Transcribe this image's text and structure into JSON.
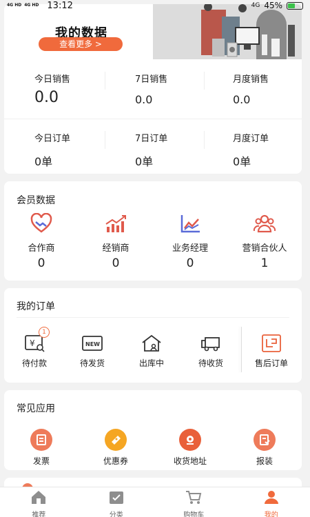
{
  "status": {
    "signal1": "4G HD",
    "signal2": "4G HD",
    "time": "13:12",
    "network": "4G",
    "battery": "45%"
  },
  "my_data": {
    "title": "我的数据",
    "more_btn": "查看更多 >",
    "sales": [
      {
        "label": "今日销售",
        "value": "0.0"
      },
      {
        "label": "7日销售",
        "value": "0.0"
      },
      {
        "label": "月度销售",
        "value": "0.0"
      }
    ],
    "orders": [
      {
        "label": "今日订单",
        "value": "0单"
      },
      {
        "label": "7日订单",
        "value": "0单"
      },
      {
        "label": "月度订单",
        "value": "0单"
      }
    ]
  },
  "member": {
    "title": "会员数据",
    "items": [
      {
        "label": "合作商",
        "value": "0",
        "icon": "handshake-heart-icon"
      },
      {
        "label": "经销商",
        "value": "0",
        "icon": "trend-up-icon"
      },
      {
        "label": "业务经理",
        "value": "0",
        "icon": "line-chart-icon"
      },
      {
        "label": "营销合伙人",
        "value": "1",
        "icon": "users-group-icon"
      }
    ]
  },
  "orders": {
    "title": "我的订单",
    "items": [
      {
        "label": "待付款",
        "icon": "payment-icon",
        "badge": "1"
      },
      {
        "label": "待发货",
        "icon": "new-box-icon"
      },
      {
        "label": "出库中",
        "icon": "warehouse-icon"
      },
      {
        "label": "待收货",
        "icon": "truck-icon"
      },
      {
        "label": "售后订单",
        "icon": "after-sales-icon"
      }
    ]
  },
  "apps": {
    "title": "常见应用",
    "items": [
      {
        "label": "发票",
        "icon": "invoice-icon",
        "color": "#ee7b5a"
      },
      {
        "label": "优惠券",
        "icon": "coupon-icon",
        "color": "#f5a623"
      },
      {
        "label": "收货地址",
        "icon": "location-icon",
        "color": "#e9603a"
      },
      {
        "label": "报装",
        "icon": "install-icon",
        "color": "#ee7b5a"
      }
    ]
  },
  "tabs": [
    {
      "label": "推荐",
      "icon": "home-icon",
      "active": false
    },
    {
      "label": "分类",
      "icon": "category-icon",
      "active": false
    },
    {
      "label": "购物车",
      "icon": "cart-icon",
      "active": false
    },
    {
      "label": "我的",
      "icon": "profile-icon",
      "active": true
    }
  ],
  "colors": {
    "accent": "#f06a3c",
    "member_icon": "#e05a4c",
    "member_icon2": "#5a6bd8"
  }
}
